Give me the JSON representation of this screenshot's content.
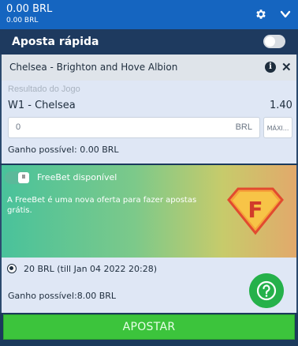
{
  "header": {
    "balance_main": "0.00 BRL",
    "balance_sub": "0.00 BRL",
    "settings_icon": "gear-icon",
    "collapse_icon": "chevron-down-icon"
  },
  "quick_bet": {
    "label": "Aposta rápida",
    "enabled": false
  },
  "event": {
    "name": "Chelsea - Brighton and Hove Albion",
    "info_icon": "info-icon",
    "close_icon": "close-icon",
    "info_glyph": "i",
    "close_glyph": "✕"
  },
  "bet": {
    "market": "Resultado do Jogo",
    "selection": "W1 - Chelsea",
    "odds": "1.40",
    "stake_value": "0",
    "stake_currency": "BRL",
    "max_label": "MÁXI...",
    "possible_gain": "Ganho possível:  0.00 BRL"
  },
  "freebet": {
    "toggle_glyph": "II",
    "title": "FreeBet disponível",
    "description": "A FreeBet é uma nova oferta para fazer apostas grátis.",
    "logo_letter": "F",
    "colors": {
      "start": "#49c29b",
      "end": "#e2a96b"
    }
  },
  "offer": {
    "text": "20 BRL (till Jan 04 2022 20:28)",
    "selected": true,
    "possible_gain": "Ganho possível:8.00 BRL",
    "help_icon": "question-icon"
  },
  "submit": {
    "label": "APOSTAR",
    "color": "#3cc43c"
  },
  "colors": {
    "topbar": "#1565c0",
    "panel_dark": "#1e3a5f",
    "panel_light": "#dfe7f5"
  }
}
